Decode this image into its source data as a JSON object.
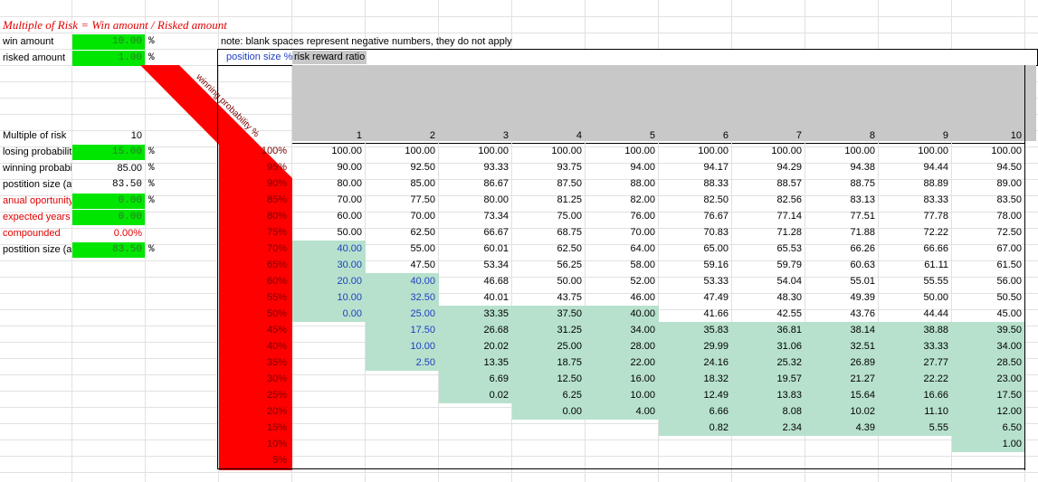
{
  "title": "Multiple of Risk = Win amount / Risked amount",
  "note": "note: blank spaces represent negative numbers, they do not apply",
  "tabs": [
    "position size %",
    "risk reward ratio"
  ],
  "rotated_label": "winning probability %",
  "inputs": [
    {
      "label": "win amount",
      "value": "10.00",
      "unit": "%",
      "green": true
    },
    {
      "label": "risked amount",
      "value": "1.00",
      "unit": "%",
      "green": true
    }
  ],
  "params": [
    {
      "label": "Multiple of risk",
      "value": "10",
      "unit": "",
      "green": false,
      "red": false
    },
    {
      "label": "losing probabilit",
      "value": "15.00",
      "unit": "%",
      "green": true,
      "red": false
    },
    {
      "label": "winning probabi",
      "value": "85.00",
      "unit": "%",
      "green": false,
      "red": false
    },
    {
      "label": "postition size (as",
      "value": "83.50",
      "unit": "%",
      "green": false,
      "red": false
    },
    {
      "label": "anual oportunity",
      "value": "0.00",
      "unit": "%",
      "green": true,
      "red": true
    },
    {
      "label": "expected years",
      "value": "0.00",
      "unit": "",
      "green": true,
      "red": true
    },
    {
      "label": "compounded",
      "value": "0.00%",
      "unit": "",
      "green": false,
      "red": true
    },
    {
      "label": "postition size (as",
      "value": "83.50",
      "unit": "%",
      "green": true,
      "red": false
    }
  ],
  "col_headers": [
    "1",
    "2",
    "3",
    "4",
    "5",
    "6",
    "7",
    "8",
    "9",
    "10"
  ],
  "row_headers": [
    "100%",
    "95%",
    "90%",
    "85%",
    "80%",
    "75%",
    "70%",
    "65%",
    "60%",
    "55%",
    "50%",
    "45%",
    "40%",
    "35%",
    "30%",
    "25%",
    "20%",
    "15%",
    "10%",
    "5%"
  ],
  "table": [
    [
      "100.00",
      "100.00",
      "100.00",
      "100.00",
      "100.00",
      "100.00",
      "100.00",
      "100.00",
      "100.00",
      "100.00"
    ],
    [
      "90.00",
      "92.50",
      "93.33",
      "93.75",
      "94.00",
      "94.17",
      "94.29",
      "94.38",
      "94.44",
      "94.50"
    ],
    [
      "80.00",
      "85.00",
      "86.67",
      "87.50",
      "88.00",
      "88.33",
      "88.57",
      "88.75",
      "88.89",
      "89.00"
    ],
    [
      "70.00",
      "77.50",
      "80.00",
      "81.25",
      "82.00",
      "82.50",
      "82.56",
      "83.13",
      "83.33",
      "83.50"
    ],
    [
      "60.00",
      "70.00",
      "73.34",
      "75.00",
      "76.00",
      "76.67",
      "77.14",
      "77.51",
      "77.78",
      "78.00"
    ],
    [
      "50.00",
      "62.50",
      "66.67",
      "68.75",
      "70.00",
      "70.83",
      "71.28",
      "71.88",
      "72.22",
      "72.50"
    ],
    [
      "40.00",
      "55.00",
      "60.01",
      "62.50",
      "64.00",
      "65.00",
      "65.53",
      "66.26",
      "66.66",
      "67.00"
    ],
    [
      "30.00",
      "47.50",
      "53.34",
      "56.25",
      "58.00",
      "59.16",
      "59.79",
      "60.63",
      "61.11",
      "61.50"
    ],
    [
      "20.00",
      "40.00",
      "46.68",
      "50.00",
      "52.00",
      "53.33",
      "54.04",
      "55.01",
      "55.55",
      "56.00"
    ],
    [
      "10.00",
      "32.50",
      "40.01",
      "43.75",
      "46.00",
      "47.49",
      "48.30",
      "49.39",
      "50.00",
      "50.50"
    ],
    [
      "0.00",
      "25.00",
      "33.35",
      "37.50",
      "40.00",
      "41.66",
      "42.55",
      "43.76",
      "44.44",
      "45.00"
    ],
    [
      "",
      "17.50",
      "26.68",
      "31.25",
      "34.00",
      "35.83",
      "36.81",
      "38.14",
      "38.88",
      "39.50"
    ],
    [
      "",
      "10.00",
      "20.02",
      "25.00",
      "28.00",
      "29.99",
      "31.06",
      "32.51",
      "33.33",
      "34.00"
    ],
    [
      "",
      "2.50",
      "13.35",
      "18.75",
      "22.00",
      "24.16",
      "25.32",
      "26.89",
      "27.77",
      "28.50"
    ],
    [
      "",
      "",
      "6.69",
      "12.50",
      "16.00",
      "18.32",
      "19.57",
      "21.27",
      "22.22",
      "23.00"
    ],
    [
      "",
      "",
      "0.02",
      "6.25",
      "10.00",
      "12.49",
      "13.83",
      "15.64",
      "16.66",
      "17.50"
    ],
    [
      "",
      "",
      "",
      "0.00",
      "4.00",
      "6.66",
      "8.08",
      "10.02",
      "11.10",
      "12.00"
    ],
    [
      "",
      "",
      "",
      "",
      "",
      "0.82",
      "2.34",
      "4.39",
      "5.55",
      "6.50"
    ],
    [
      "",
      "",
      "",
      "",
      "",
      "",
      "",
      "",
      "",
      "1.00"
    ],
    [
      "",
      "",
      "",
      "",
      "",
      "",
      "",
      "",
      "",
      ""
    ]
  ],
  "teal_ranges": [
    {
      "col": 0,
      "from": 6,
      "to": 10
    },
    {
      "col": 1,
      "from": 8,
      "to": 13
    },
    {
      "col": 2,
      "from": 10,
      "to": 15
    },
    {
      "col": 3,
      "from": 10,
      "to": 16
    },
    {
      "col": 4,
      "from": 10,
      "to": 16
    },
    {
      "col": 5,
      "from": 11,
      "to": 17
    },
    {
      "col": 6,
      "from": 11,
      "to": 17
    },
    {
      "col": 7,
      "from": 11,
      "to": 17
    },
    {
      "col": 8,
      "from": 11,
      "to": 17
    },
    {
      "col": 9,
      "from": 11,
      "to": 18
    }
  ],
  "colors": {
    "green": "#00e600",
    "red": "#ff0000",
    "teal": "#b7e1cd",
    "header_gray": "#c8c8c8",
    "blue_text": "#1f3fbf"
  }
}
